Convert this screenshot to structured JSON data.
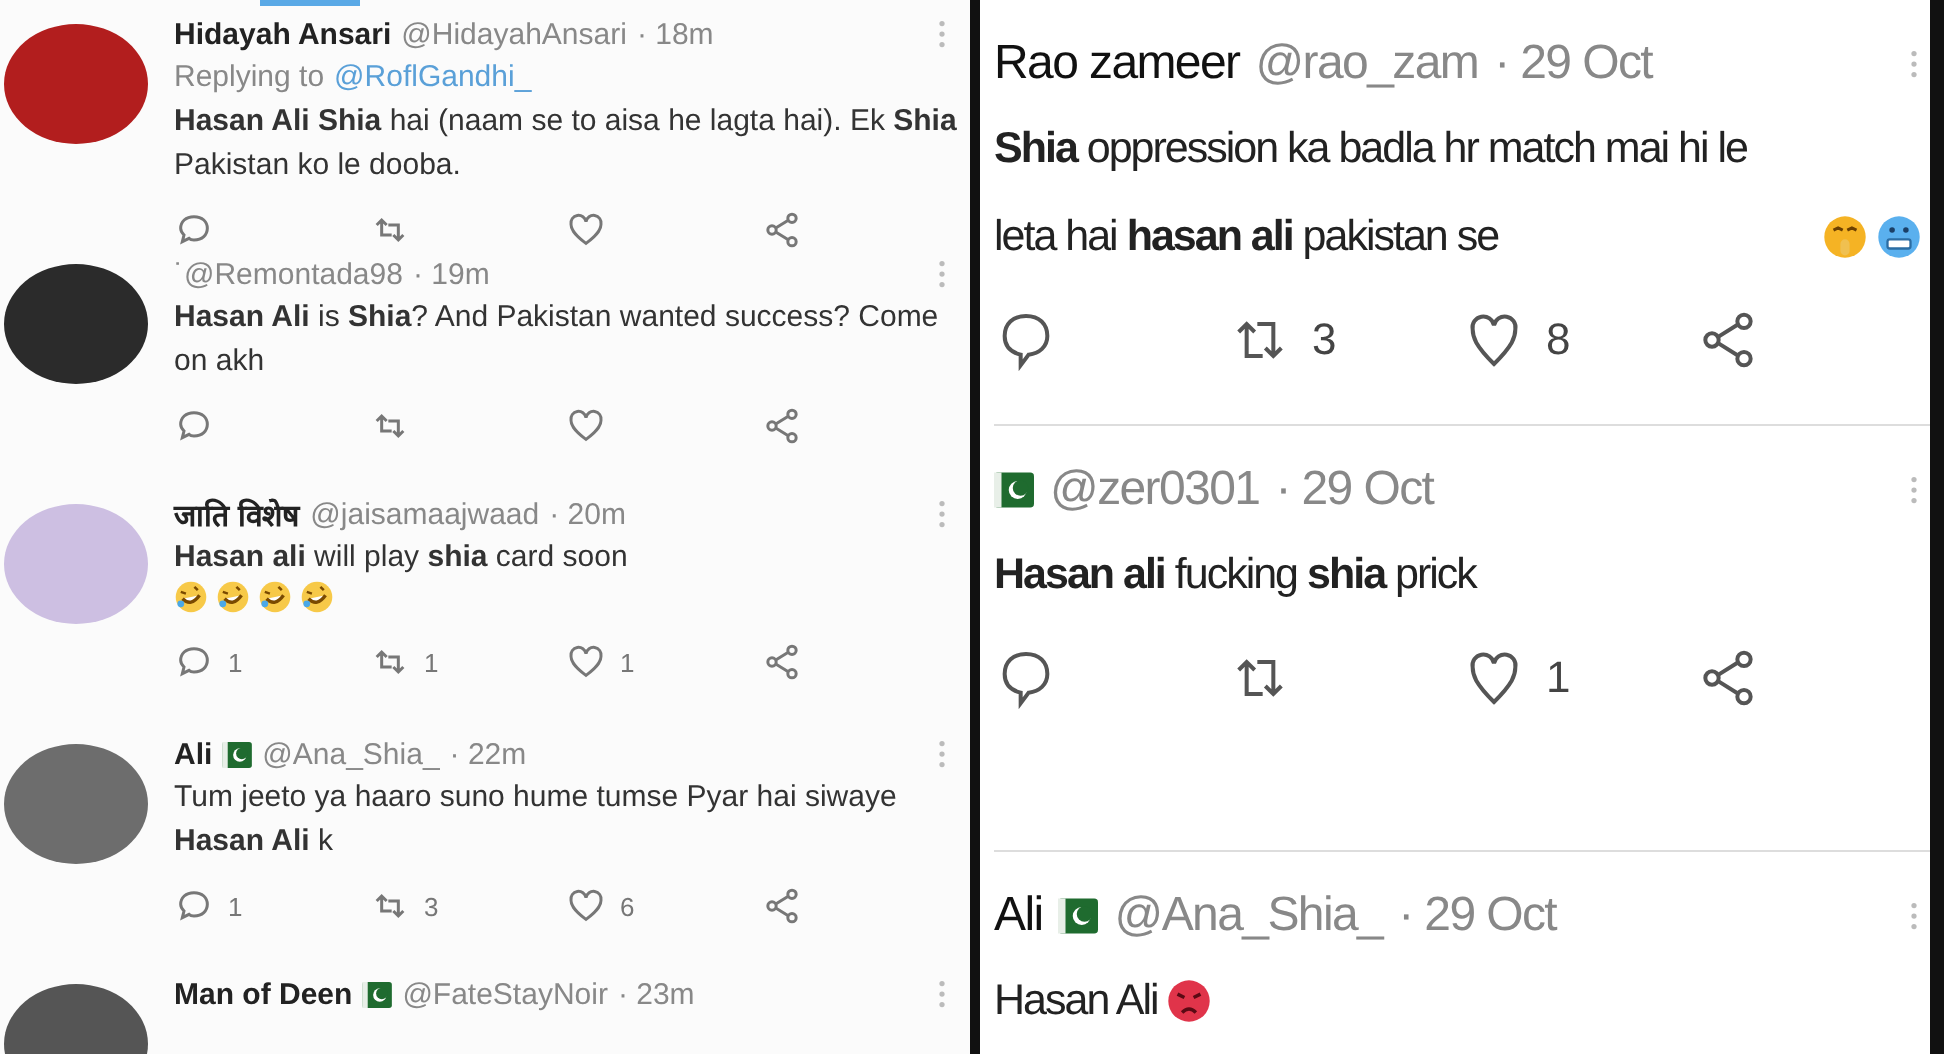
{
  "left_feed": {
    "tweets": [
      {
        "name": "Hidayah Ansari",
        "flag": false,
        "handle": "@HidayahAnsari",
        "time": "· 18m",
        "replying_to": {
          "prefix": "Replying to",
          "handle": "@RoflGandhi_"
        },
        "body": "**Hasan Ali Shia** hai (naam se to aisa he lagta hai). Ek **Shia** Pakistan ko le dooba.",
        "actions": [
          {
            "kind": "reply"
          },
          {
            "kind": "retweet"
          },
          {
            "kind": "like"
          },
          {
            "kind": "share"
          }
        ]
      },
      {
        "handle": "˙@Remontada98",
        "flag": false,
        "time": "· 19m",
        "body": "**Hasan Ali** is **Shia**? And Pakistan wanted success? Come on akh",
        "actions": [
          {
            "kind": "reply"
          },
          {
            "kind": "retweet"
          },
          {
            "kind": "like"
          },
          {
            "kind": "share"
          }
        ]
      },
      {
        "name": "जाति विशेष",
        "flag": false,
        "handle": "@jaisamaajwaad",
        "time": "· 20m",
        "body": "**Hasan ali** will play **shia** card soon",
        "emoji": [
          {
            "kind": "rofl"
          },
          {
            "kind": "rofl"
          },
          {
            "kind": "rofl"
          },
          {
            "kind": "rofl"
          }
        ],
        "actions": [
          {
            "kind": "reply",
            "count": "1"
          },
          {
            "kind": "retweet",
            "count": "1"
          },
          {
            "kind": "like",
            "count": "1"
          },
          {
            "kind": "share"
          }
        ]
      },
      {
        "name": "Ali",
        "flag": true,
        "handle": "@Ana_Shia_",
        "time": "· 22m",
        "body": "Tum jeeto ya haaro suno hume tumse Pyar hai siwaye **Hasan Ali** k",
        "actions": [
          {
            "kind": "reply",
            "count": "1"
          },
          {
            "kind": "retweet",
            "count": "3"
          },
          {
            "kind": "like",
            "count": "6"
          },
          {
            "kind": "share"
          }
        ]
      },
      {
        "name": "Man of Deen",
        "flag": true,
        "handle": "@FateStayNoir",
        "time": "· 23m"
      }
    ]
  },
  "right_feed": {
    "tweets": [
      {
        "name": "Rao zameer",
        "flag": false,
        "handle": "@rao_zam",
        "time": "· 29 Oct",
        "body": "**Shia** oppression ka badla hr match mai hi le leta hai **hasan ali** pakistan se",
        "emoji": [
          {
            "kind": "shush"
          },
          {
            "kind": "cold"
          }
        ],
        "actions": [
          {
            "kind": "reply"
          },
          {
            "kind": "retweet",
            "count": "3"
          },
          {
            "kind": "like",
            "count": "8"
          },
          {
            "kind": "share"
          }
        ]
      },
      {
        "flag": true,
        "handle": "@zer0301",
        "time": "· 29 Oct",
        "body": "**Hasan ali** fucking **shia** prick",
        "actions": [
          {
            "kind": "reply"
          },
          {
            "kind": "retweet"
          },
          {
            "kind": "like",
            "count": "1"
          },
          {
            "kind": "share"
          }
        ]
      },
      {
        "name": "Ali",
        "flag": true,
        "handle": "@Ana_Shia_",
        "time": "· 29 Oct",
        "body": "Hasan Ali",
        "emoji": [
          {
            "kind": "angry"
          }
        ]
      }
    ]
  }
}
